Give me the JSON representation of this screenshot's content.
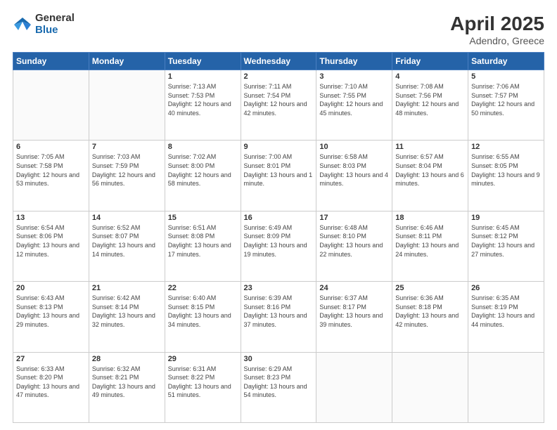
{
  "logo": {
    "general": "General",
    "blue": "Blue"
  },
  "header": {
    "month": "April 2025",
    "location": "Adendro, Greece"
  },
  "weekdays": [
    "Sunday",
    "Monday",
    "Tuesday",
    "Wednesday",
    "Thursday",
    "Friday",
    "Saturday"
  ],
  "weeks": [
    [
      {
        "day": "",
        "info": ""
      },
      {
        "day": "",
        "info": ""
      },
      {
        "day": "1",
        "info": "Sunrise: 7:13 AM\nSunset: 7:53 PM\nDaylight: 12 hours and 40 minutes."
      },
      {
        "day": "2",
        "info": "Sunrise: 7:11 AM\nSunset: 7:54 PM\nDaylight: 12 hours and 42 minutes."
      },
      {
        "day": "3",
        "info": "Sunrise: 7:10 AM\nSunset: 7:55 PM\nDaylight: 12 hours and 45 minutes."
      },
      {
        "day": "4",
        "info": "Sunrise: 7:08 AM\nSunset: 7:56 PM\nDaylight: 12 hours and 48 minutes."
      },
      {
        "day": "5",
        "info": "Sunrise: 7:06 AM\nSunset: 7:57 PM\nDaylight: 12 hours and 50 minutes."
      }
    ],
    [
      {
        "day": "6",
        "info": "Sunrise: 7:05 AM\nSunset: 7:58 PM\nDaylight: 12 hours and 53 minutes."
      },
      {
        "day": "7",
        "info": "Sunrise: 7:03 AM\nSunset: 7:59 PM\nDaylight: 12 hours and 56 minutes."
      },
      {
        "day": "8",
        "info": "Sunrise: 7:02 AM\nSunset: 8:00 PM\nDaylight: 12 hours and 58 minutes."
      },
      {
        "day": "9",
        "info": "Sunrise: 7:00 AM\nSunset: 8:01 PM\nDaylight: 13 hours and 1 minute."
      },
      {
        "day": "10",
        "info": "Sunrise: 6:58 AM\nSunset: 8:03 PM\nDaylight: 13 hours and 4 minutes."
      },
      {
        "day": "11",
        "info": "Sunrise: 6:57 AM\nSunset: 8:04 PM\nDaylight: 13 hours and 6 minutes."
      },
      {
        "day": "12",
        "info": "Sunrise: 6:55 AM\nSunset: 8:05 PM\nDaylight: 13 hours and 9 minutes."
      }
    ],
    [
      {
        "day": "13",
        "info": "Sunrise: 6:54 AM\nSunset: 8:06 PM\nDaylight: 13 hours and 12 minutes."
      },
      {
        "day": "14",
        "info": "Sunrise: 6:52 AM\nSunset: 8:07 PM\nDaylight: 13 hours and 14 minutes."
      },
      {
        "day": "15",
        "info": "Sunrise: 6:51 AM\nSunset: 8:08 PM\nDaylight: 13 hours and 17 minutes."
      },
      {
        "day": "16",
        "info": "Sunrise: 6:49 AM\nSunset: 8:09 PM\nDaylight: 13 hours and 19 minutes."
      },
      {
        "day": "17",
        "info": "Sunrise: 6:48 AM\nSunset: 8:10 PM\nDaylight: 13 hours and 22 minutes."
      },
      {
        "day": "18",
        "info": "Sunrise: 6:46 AM\nSunset: 8:11 PM\nDaylight: 13 hours and 24 minutes."
      },
      {
        "day": "19",
        "info": "Sunrise: 6:45 AM\nSunset: 8:12 PM\nDaylight: 13 hours and 27 minutes."
      }
    ],
    [
      {
        "day": "20",
        "info": "Sunrise: 6:43 AM\nSunset: 8:13 PM\nDaylight: 13 hours and 29 minutes."
      },
      {
        "day": "21",
        "info": "Sunrise: 6:42 AM\nSunset: 8:14 PM\nDaylight: 13 hours and 32 minutes."
      },
      {
        "day": "22",
        "info": "Sunrise: 6:40 AM\nSunset: 8:15 PM\nDaylight: 13 hours and 34 minutes."
      },
      {
        "day": "23",
        "info": "Sunrise: 6:39 AM\nSunset: 8:16 PM\nDaylight: 13 hours and 37 minutes."
      },
      {
        "day": "24",
        "info": "Sunrise: 6:37 AM\nSunset: 8:17 PM\nDaylight: 13 hours and 39 minutes."
      },
      {
        "day": "25",
        "info": "Sunrise: 6:36 AM\nSunset: 8:18 PM\nDaylight: 13 hours and 42 minutes."
      },
      {
        "day": "26",
        "info": "Sunrise: 6:35 AM\nSunset: 8:19 PM\nDaylight: 13 hours and 44 minutes."
      }
    ],
    [
      {
        "day": "27",
        "info": "Sunrise: 6:33 AM\nSunset: 8:20 PM\nDaylight: 13 hours and 47 minutes."
      },
      {
        "day": "28",
        "info": "Sunrise: 6:32 AM\nSunset: 8:21 PM\nDaylight: 13 hours and 49 minutes."
      },
      {
        "day": "29",
        "info": "Sunrise: 6:31 AM\nSunset: 8:22 PM\nDaylight: 13 hours and 51 minutes."
      },
      {
        "day": "30",
        "info": "Sunrise: 6:29 AM\nSunset: 8:23 PM\nDaylight: 13 hours and 54 minutes."
      },
      {
        "day": "",
        "info": ""
      },
      {
        "day": "",
        "info": ""
      },
      {
        "day": "",
        "info": ""
      }
    ]
  ]
}
